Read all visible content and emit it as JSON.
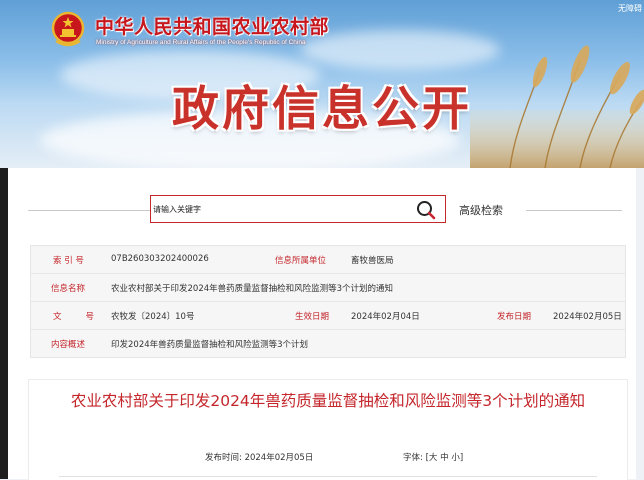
{
  "header": {
    "top_link": "无障碍",
    "ministry_cn": "中华人民共和国农业农村部",
    "ministry_en": "Ministry of Agriculture and Rural Affairs of the People's Republic of China",
    "banner_title": "政府信息公开"
  },
  "search": {
    "placeholder": "请输入关键字",
    "advanced_label": "高级检索"
  },
  "meta": {
    "index_label": "索 引 号",
    "index_value": "07B260303202400026",
    "org_label": "信息所属单位",
    "org_value": "畜牧兽医局",
    "name_label": "信息名称",
    "name_value": "农业农村部关于印发2024年兽药质量监督抽检和风险监测等3个计划的通知",
    "docno_label": "文号",
    "docno_value": "农牧发〔2024〕10号",
    "effective_label": "生效日期",
    "effective_value": "2024年02月04日",
    "published_label": "发布日期",
    "published_value": "2024年02月05日",
    "summary_label": "内容概述",
    "summary_value": "印发2024年兽药质量监督抽检和风险监测等3个计划"
  },
  "article": {
    "title": "农业农村部关于印发2024年兽药质量监督抽检和风险监测等3个计划的通知",
    "pub_time_label": "发布时间:",
    "pub_time_value": "2024年02月05日",
    "font_label": "字体:",
    "font_open": "[",
    "font_large": "大",
    "font_medium": "中",
    "font_small": "小",
    "font_close": "]"
  },
  "colors": {
    "brand_red": "#c4262b",
    "sky_blue": "#8ec0ea"
  }
}
